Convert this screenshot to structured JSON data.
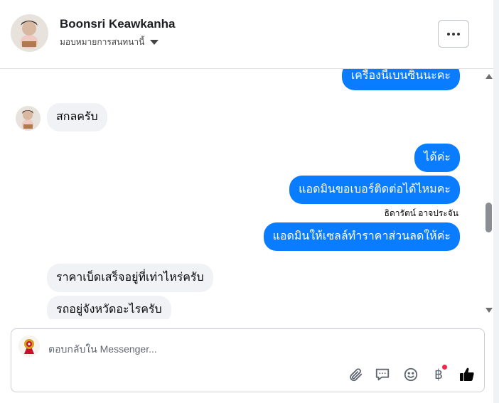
{
  "header": {
    "contact_name": "Boonsri Keawkanha",
    "assign_label": "มอบหมายการสนทนานี้"
  },
  "messages": [
    {
      "direction": "outgoing",
      "text": "เครื่องนี้เบนซินนะคะ"
    },
    {
      "direction": "incoming",
      "text": "สกลครับ"
    },
    {
      "direction": "outgoing",
      "text": "ได้ค่ะ"
    },
    {
      "direction": "outgoing",
      "text": "แอดมินขอเบอร์ติดต่อได้ไหมคะ"
    },
    {
      "direction": "outgoing",
      "text": "แอดมินให้เซลล์ทำราคาส่วนลดให้ค่ะ",
      "sender": "ธิดารัตน์ อาจประจัน"
    },
    {
      "direction": "incoming",
      "text": "ราคาเบ็ดเสร็จอยู่ที่เท่าไหร่ครับ"
    },
    {
      "direction": "incoming",
      "text": "รถอยู่จังหวัดอะไรครับ"
    }
  ],
  "composer": {
    "placeholder": "ตอบกลับใน Messenger..."
  },
  "colors": {
    "outgoing_bubble": "#0a7cff",
    "incoming_bubble": "#f0f2f5",
    "like_icon": "#050505",
    "notification_dot": "#f02849"
  },
  "icons": [
    "more-icon",
    "caret-down-icon",
    "attachment-icon",
    "saved-reply-icon",
    "emoji-icon",
    "baht-icon",
    "like-icon"
  ]
}
